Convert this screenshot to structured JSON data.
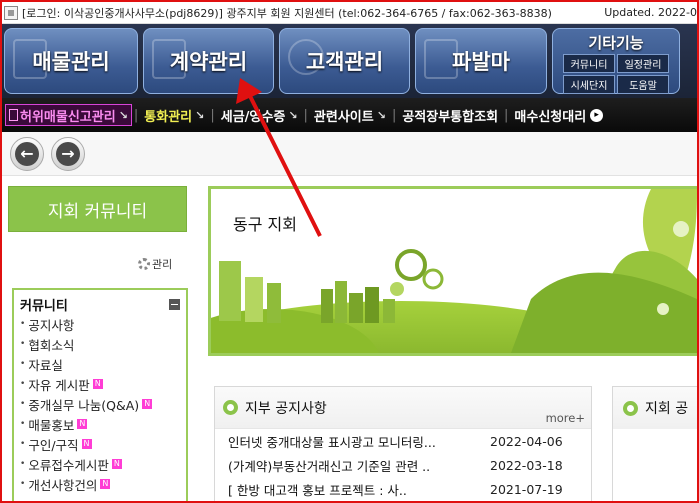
{
  "infobar": {
    "login_text": "[로그인: 이삭공인중개사사무소(pdj8629)] 광주지부 회원 지원센터 (tel:062-364-6765 / fax:062-363-8838)",
    "updated": "Updated. 2022-0"
  },
  "mainmenu": {
    "btn1": "매물관리",
    "btn2": "계약관리",
    "btn3": "고객관리",
    "btn4": "파발마",
    "extra_title": "기타기능",
    "extra_items": [
      "커뮤니티",
      "일정관리",
      "시세단지",
      "도움말"
    ]
  },
  "submenu": {
    "items": [
      {
        "label": "허위매물신고관리",
        "arrow": "↘"
      },
      {
        "label": "통화관리",
        "arrow": "↘"
      },
      {
        "label": "세금/영수증",
        "arrow": "↘"
      },
      {
        "label": "관련사이트",
        "arrow": "↘"
      },
      {
        "label": "공적장부통합조회",
        "arrow": ""
      },
      {
        "label": "매수신청대리",
        "arrow": ""
      }
    ],
    "plus": "▸"
  },
  "toolbar": {
    "back": "←",
    "forward": "→"
  },
  "sidebar": {
    "community_button": "지회 커뮤니티",
    "manage_label": "관리",
    "menu_title": "커뮤니티",
    "items": [
      {
        "label": "공지사항",
        "new": false
      },
      {
        "label": "협회소식",
        "new": false
      },
      {
        "label": "자료실",
        "new": false
      },
      {
        "label": "자유 게시판",
        "new": true
      },
      {
        "label": "중개실무 나눔(Q&A)",
        "new": true
      },
      {
        "label": "매물홍보",
        "new": true
      },
      {
        "label": "구인/구직",
        "new": true
      },
      {
        "label": "오류접수게시판",
        "new": true
      },
      {
        "label": "개선사항건의",
        "new": true
      }
    ],
    "new_badge": "N"
  },
  "banner": {
    "title": "동구 지회"
  },
  "notice": {
    "title": "지부 공지사항",
    "more": "more+",
    "rows": [
      {
        "title": "인터넷 중개대상물 표시광고 모니터링...",
        "date": "2022-04-06"
      },
      {
        "title": "(가계약)부동산거래신고 기준일 관련 ..",
        "date": "2022-03-18"
      },
      {
        "title": "[ 한방 대고객 홍보 프로젝트 : 사..",
        "date": "2021-07-19"
      }
    ]
  },
  "notice2": {
    "title": "지회 공"
  },
  "colors": {
    "accent_red": "#e01010",
    "green": "#8bc34a",
    "menu_blue": "#3c5b93"
  }
}
